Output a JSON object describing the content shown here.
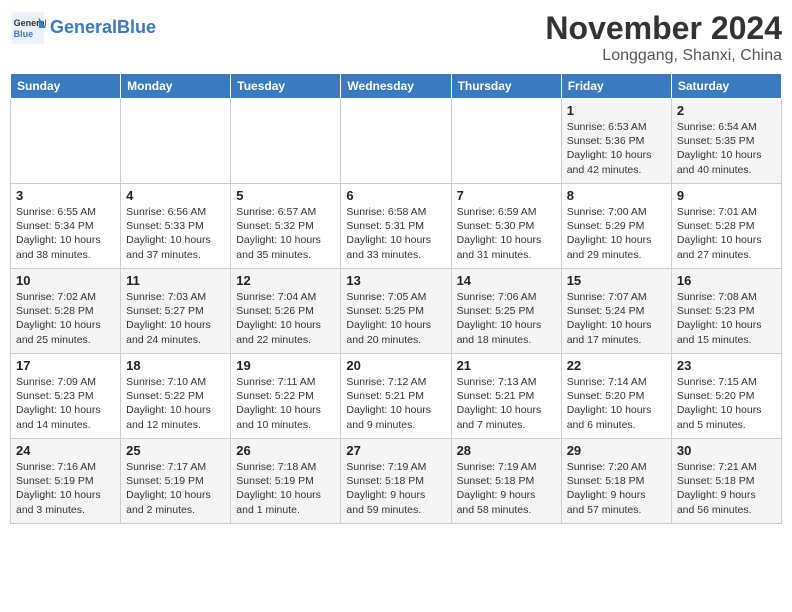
{
  "header": {
    "logo_line1": "General",
    "logo_line2": "Blue",
    "month": "November 2024",
    "location": "Longgang, Shanxi, China"
  },
  "weekdays": [
    "Sunday",
    "Monday",
    "Tuesday",
    "Wednesday",
    "Thursday",
    "Friday",
    "Saturday"
  ],
  "weeks": [
    [
      {
        "day": "",
        "info": ""
      },
      {
        "day": "",
        "info": ""
      },
      {
        "day": "",
        "info": ""
      },
      {
        "day": "",
        "info": ""
      },
      {
        "day": "",
        "info": ""
      },
      {
        "day": "1",
        "info": "Sunrise: 6:53 AM\nSunset: 5:36 PM\nDaylight: 10 hours\nand 42 minutes."
      },
      {
        "day": "2",
        "info": "Sunrise: 6:54 AM\nSunset: 5:35 PM\nDaylight: 10 hours\nand 40 minutes."
      }
    ],
    [
      {
        "day": "3",
        "info": "Sunrise: 6:55 AM\nSunset: 5:34 PM\nDaylight: 10 hours\nand 38 minutes."
      },
      {
        "day": "4",
        "info": "Sunrise: 6:56 AM\nSunset: 5:33 PM\nDaylight: 10 hours\nand 37 minutes."
      },
      {
        "day": "5",
        "info": "Sunrise: 6:57 AM\nSunset: 5:32 PM\nDaylight: 10 hours\nand 35 minutes."
      },
      {
        "day": "6",
        "info": "Sunrise: 6:58 AM\nSunset: 5:31 PM\nDaylight: 10 hours\nand 33 minutes."
      },
      {
        "day": "7",
        "info": "Sunrise: 6:59 AM\nSunset: 5:30 PM\nDaylight: 10 hours\nand 31 minutes."
      },
      {
        "day": "8",
        "info": "Sunrise: 7:00 AM\nSunset: 5:29 PM\nDaylight: 10 hours\nand 29 minutes."
      },
      {
        "day": "9",
        "info": "Sunrise: 7:01 AM\nSunset: 5:28 PM\nDaylight: 10 hours\nand 27 minutes."
      }
    ],
    [
      {
        "day": "10",
        "info": "Sunrise: 7:02 AM\nSunset: 5:28 PM\nDaylight: 10 hours\nand 25 minutes."
      },
      {
        "day": "11",
        "info": "Sunrise: 7:03 AM\nSunset: 5:27 PM\nDaylight: 10 hours\nand 24 minutes."
      },
      {
        "day": "12",
        "info": "Sunrise: 7:04 AM\nSunset: 5:26 PM\nDaylight: 10 hours\nand 22 minutes."
      },
      {
        "day": "13",
        "info": "Sunrise: 7:05 AM\nSunset: 5:25 PM\nDaylight: 10 hours\nand 20 minutes."
      },
      {
        "day": "14",
        "info": "Sunrise: 7:06 AM\nSunset: 5:25 PM\nDaylight: 10 hours\nand 18 minutes."
      },
      {
        "day": "15",
        "info": "Sunrise: 7:07 AM\nSunset: 5:24 PM\nDaylight: 10 hours\nand 17 minutes."
      },
      {
        "day": "16",
        "info": "Sunrise: 7:08 AM\nSunset: 5:23 PM\nDaylight: 10 hours\nand 15 minutes."
      }
    ],
    [
      {
        "day": "17",
        "info": "Sunrise: 7:09 AM\nSunset: 5:23 PM\nDaylight: 10 hours\nand 14 minutes."
      },
      {
        "day": "18",
        "info": "Sunrise: 7:10 AM\nSunset: 5:22 PM\nDaylight: 10 hours\nand 12 minutes."
      },
      {
        "day": "19",
        "info": "Sunrise: 7:11 AM\nSunset: 5:22 PM\nDaylight: 10 hours\nand 10 minutes."
      },
      {
        "day": "20",
        "info": "Sunrise: 7:12 AM\nSunset: 5:21 PM\nDaylight: 10 hours\nand 9 minutes."
      },
      {
        "day": "21",
        "info": "Sunrise: 7:13 AM\nSunset: 5:21 PM\nDaylight: 10 hours\nand 7 minutes."
      },
      {
        "day": "22",
        "info": "Sunrise: 7:14 AM\nSunset: 5:20 PM\nDaylight: 10 hours\nand 6 minutes."
      },
      {
        "day": "23",
        "info": "Sunrise: 7:15 AM\nSunset: 5:20 PM\nDaylight: 10 hours\nand 5 minutes."
      }
    ],
    [
      {
        "day": "24",
        "info": "Sunrise: 7:16 AM\nSunset: 5:19 PM\nDaylight: 10 hours\nand 3 minutes."
      },
      {
        "day": "25",
        "info": "Sunrise: 7:17 AM\nSunset: 5:19 PM\nDaylight: 10 hours\nand 2 minutes."
      },
      {
        "day": "26",
        "info": "Sunrise: 7:18 AM\nSunset: 5:19 PM\nDaylight: 10 hours\nand 1 minute."
      },
      {
        "day": "27",
        "info": "Sunrise: 7:19 AM\nSunset: 5:18 PM\nDaylight: 9 hours\nand 59 minutes."
      },
      {
        "day": "28",
        "info": "Sunrise: 7:19 AM\nSunset: 5:18 PM\nDaylight: 9 hours\nand 58 minutes."
      },
      {
        "day": "29",
        "info": "Sunrise: 7:20 AM\nSunset: 5:18 PM\nDaylight: 9 hours\nand 57 minutes."
      },
      {
        "day": "30",
        "info": "Sunrise: 7:21 AM\nSunset: 5:18 PM\nDaylight: 9 hours\nand 56 minutes."
      }
    ]
  ]
}
